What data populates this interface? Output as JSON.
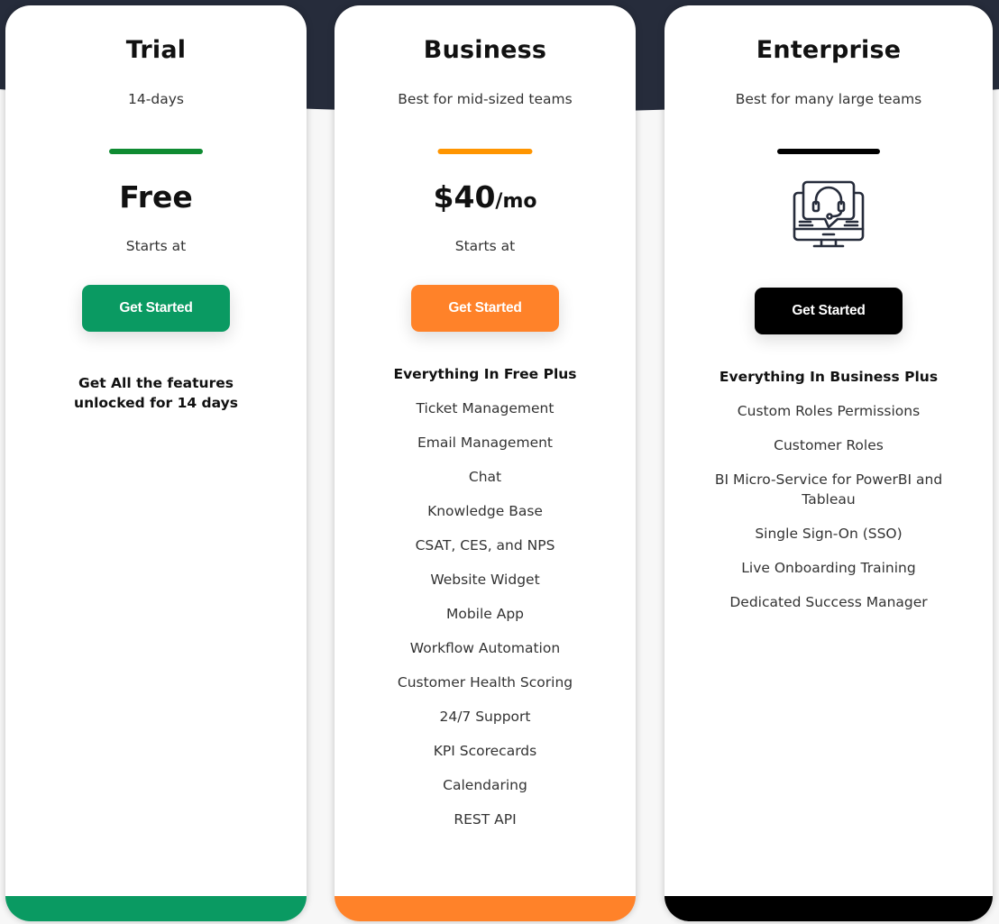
{
  "colors": {
    "hero_background": "#262c3b",
    "trial_accent": "#0a9a62",
    "trial_bar": "#0f8b32",
    "business_accent": "#ff8229",
    "business_bar": "#ff9500",
    "enterprise_accent": "#000000",
    "icon_stroke": "#262c3b"
  },
  "plans": [
    {
      "name": "Trial",
      "subtitle": "14-days",
      "price": "Free",
      "price_suffix": "",
      "starts_at": "Starts at",
      "cta": "Get Started",
      "note": "Get All the features unlocked for 14 days"
    },
    {
      "name": "Business",
      "subtitle": "Best for mid-sized teams",
      "price": "$40",
      "price_suffix": "/mo",
      "starts_at": "Starts at",
      "cta": "Get Started",
      "features_heading": "Everything In Free Plus",
      "features": [
        "Ticket Management",
        "Email Management",
        "Chat",
        "Knowledge Base",
        "CSAT, CES, and NPS",
        "Website Widget",
        "Mobile App",
        "Workflow Automation",
        "Customer Health Scoring",
        "24/7 Support",
        "KPI Scorecards",
        "Calendaring",
        "REST API"
      ]
    },
    {
      "name": "Enterprise",
      "subtitle": "Best for many large teams",
      "icon": "customer-support-monitor-icon",
      "cta": "Get Started",
      "features_heading": "Everything In Business Plus",
      "features": [
        "Custom Roles Permissions",
        "Customer Roles",
        "BI Micro-Service for PowerBI and Tableau",
        "Single Sign-On (SSO)",
        "Live Onboarding Training",
        "Dedicated Success Manager"
      ]
    }
  ]
}
